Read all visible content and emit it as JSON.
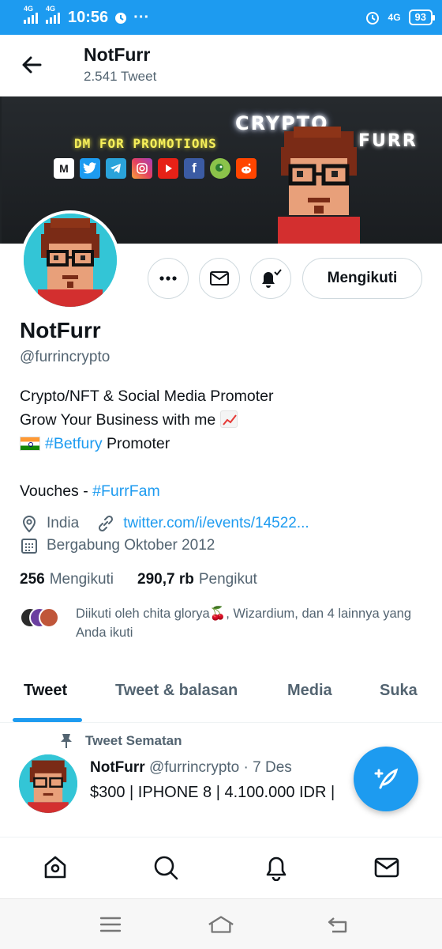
{
  "status_bar": {
    "network_1": "4G",
    "network_2": "4G",
    "time": "10:56",
    "more": "···",
    "network_right": "4G",
    "battery": "93",
    "colors": {
      "background": "#1d9bf0"
    }
  },
  "header": {
    "back_icon": "arrow-left-icon",
    "title": "NotFurr",
    "tweet_count": "2.541 Tweet"
  },
  "banner": {
    "headline_1": "CRYPTO",
    "headline_2": "FURR",
    "promo": "DM FOR PROMOTIONS",
    "social_icons": [
      "coinmarketcap-icon",
      "twitter-icon",
      "telegram-icon",
      "instagram-icon",
      "youtube-icon",
      "facebook-icon",
      "parrot-icon",
      "reddit-icon"
    ]
  },
  "actions": {
    "more_icon": "more-dots-icon",
    "message_icon": "mail-icon",
    "notify_icon": "bell-check-icon",
    "follow_label": "Mengikuti"
  },
  "profile": {
    "name": "NotFurr",
    "handle": "@furrincrypto",
    "bio_line_1": "Crypto/NFT & Social Media Promoter",
    "bio_line_2": "Grow Your Business with me",
    "bio_line_3_hashtag": "#Betfury",
    "bio_line_3_text": " Promoter",
    "bio_line_4_text": "Vouches - ",
    "bio_line_4_hashtag": "#FurrFam",
    "location": "India",
    "website": "twitter.com/i/events/14522...",
    "joined": "Bergabung Oktober 2012",
    "following_count": "256",
    "following_label": "Mengikuti",
    "followers_count": "290,7 rb",
    "followers_label": "Pengikut",
    "followed_by": "Diikuti oleh chita glorya🍒, Wizardium, dan 4 lainnya yang Anda ikuti"
  },
  "tabs": [
    {
      "label": "Tweet",
      "active": true
    },
    {
      "label": "Tweet & balasan",
      "active": false
    },
    {
      "label": "Media",
      "active": false
    },
    {
      "label": "Suka",
      "active": false
    }
  ],
  "pinned_tweet": {
    "pinned_label": "Tweet Sematan",
    "author": "NotFurr",
    "handle": "@furrincrypto",
    "separator": "·",
    "date": "7 Des",
    "text": "$300 | IPHONE 8 | 4.100.000 IDR |"
  },
  "fab": {
    "icon": "compose-tweet-icon"
  },
  "bottom_nav": [
    "home-icon",
    "search-icon",
    "notifications-bell-icon",
    "messages-mail-icon"
  ],
  "system_nav": [
    "menu-icon",
    "home-outline-icon",
    "back-icon"
  ],
  "colors": {
    "accent": "#1d9bf0",
    "text": "#0f1419",
    "secondary": "#536471"
  }
}
